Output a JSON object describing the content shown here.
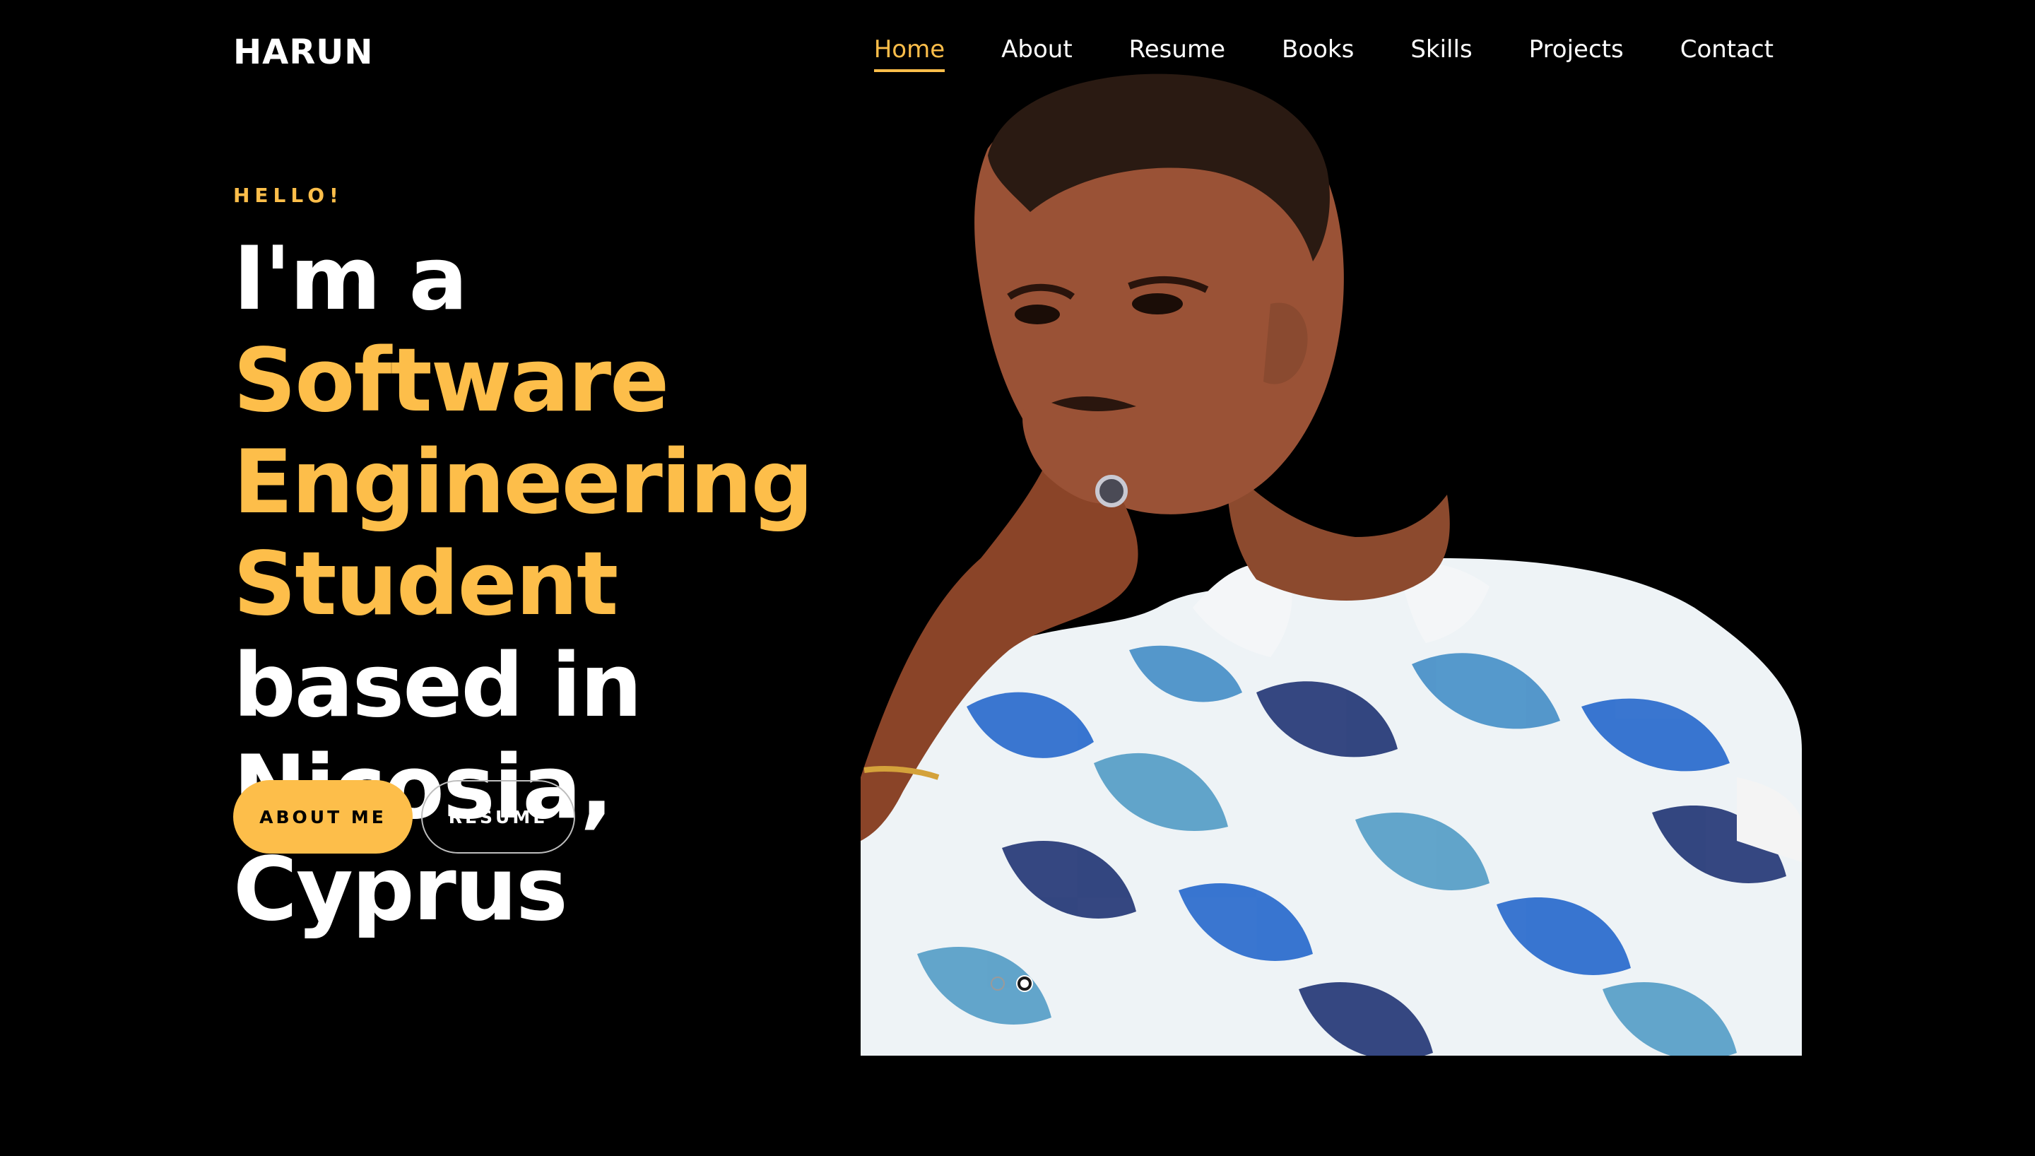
{
  "brand": {
    "name": "HARUN"
  },
  "nav": {
    "items": [
      {
        "label": "Home",
        "active": true
      },
      {
        "label": "About",
        "active": false
      },
      {
        "label": "Resume",
        "active": false
      },
      {
        "label": "Books",
        "active": false
      },
      {
        "label": "Skills",
        "active": false
      },
      {
        "label": "Projects",
        "active": false
      },
      {
        "label": "Contact",
        "active": false
      }
    ]
  },
  "hero": {
    "greeting": "HELLO!",
    "headline": {
      "part1": "I'm a ",
      "accent": "Software Engineering Student",
      "part2": " based in Nicosia, Cyprus"
    },
    "buttons": {
      "primary": "ABOUT ME",
      "secondary": "RESUME"
    },
    "slider": {
      "count": 2,
      "active_index": 1
    }
  },
  "colors": {
    "background": "#000000",
    "accent": "#FDBE4A",
    "text": "#FFFFFF"
  }
}
